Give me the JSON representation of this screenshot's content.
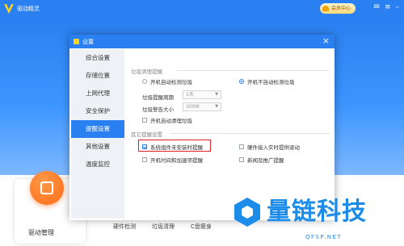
{
  "app": {
    "title": "驱动精灵",
    "vip_label": "会员中心",
    "tool_label": "驱动管理",
    "nav_labels": [
      "硬件检测",
      "垃圾清理",
      "C盘瘦身"
    ]
  },
  "dialog": {
    "title": "设置",
    "close_icon": "×",
    "sidebar": [
      {
        "label": "综合设置",
        "active": false
      },
      {
        "label": "存储位置",
        "active": false
      },
      {
        "label": "上网代理",
        "active": false
      },
      {
        "label": "安全保护",
        "active": false
      },
      {
        "label": "提醒设置",
        "active": true
      },
      {
        "label": "其他设置",
        "active": false
      },
      {
        "label": "温度监控",
        "active": false
      }
    ],
    "garbage_section": {
      "title": "垃圾清理提醒",
      "radio_auto": "开机自动检测垃圾",
      "radio_no_auto": "开机不自动检测垃圾",
      "selected": "radio_no_auto",
      "period_label": "垃圾提醒周期",
      "period_value": "1天",
      "size_label": "垃圾警告大小",
      "size_value": "300M",
      "auto_clean_label": "开机自动清理垃圾",
      "auto_clean_checked": false
    },
    "other_section": {
      "title": "其它提醒设置",
      "items": [
        {
          "label": "系统组件未安装时提醒",
          "checked": true,
          "highlighted": true
        },
        {
          "label": "硬件接入实时提供驱动",
          "checked": false
        },
        {
          "label": "开机时间和加速项提醒",
          "checked": false
        },
        {
          "label": "新闻及推广提醒",
          "checked": false
        }
      ]
    }
  },
  "watermark": {
    "text": "量链科技",
    "sub": "QFSP.NET"
  },
  "colors": {
    "accent": "#2a80f0",
    "highlight": "#e02020",
    "watermark": "#1c8ce8"
  }
}
